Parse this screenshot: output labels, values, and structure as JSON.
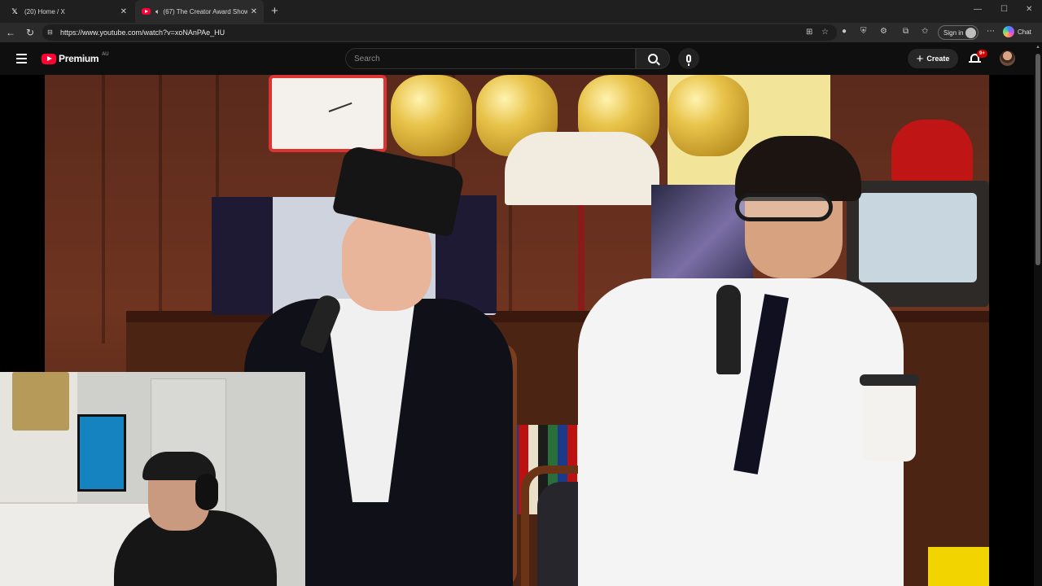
{
  "browser": {
    "tabs": [
      {
        "title": "(20) Home / X",
        "favicon": "x-icon",
        "active": false
      },
      {
        "title": "(67) The Creator Award Show",
        "favicon": "youtube-icon",
        "active": true,
        "audio": true
      }
    ],
    "url": "https://www.youtube.com/watch?v=xoNAnPAe_HU",
    "signin_label": "Sign in",
    "chat_label": "Chat"
  },
  "youtube": {
    "logo_text": "Premium",
    "region": "AU",
    "search_placeholder": "Search",
    "create_label": "Create",
    "notification_count": "9+"
  },
  "colors": {
    "brand_red": "#ff0033",
    "background": "#0f0f0f",
    "badge_red": "#cc0000"
  }
}
